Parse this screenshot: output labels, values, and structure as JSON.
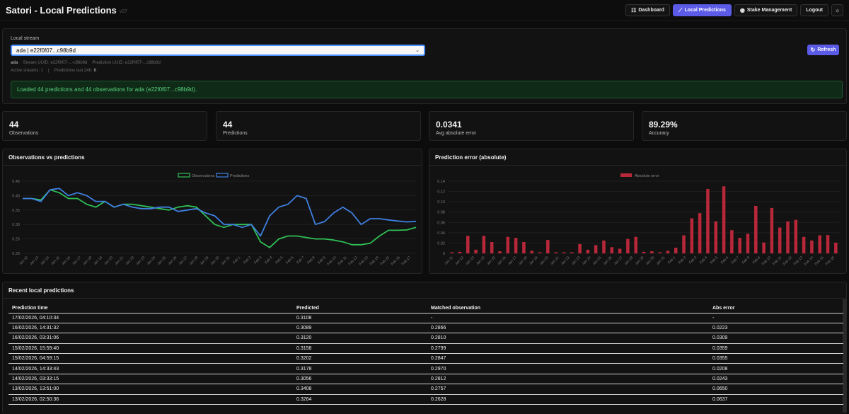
{
  "header": {
    "title": "Satori - Local Predictions",
    "version": "v27",
    "nav": [
      {
        "label": "Dashboard",
        "icon": "dashboard-icon",
        "active": false
      },
      {
        "label": "Local Predictions",
        "icon": "trend-icon",
        "active": true
      },
      {
        "label": "Stake Management",
        "icon": "stake-icon",
        "active": false
      },
      {
        "label": "Logout",
        "icon": "",
        "active": false
      }
    ],
    "theme_toggle_icon": "sun-icon"
  },
  "stream": {
    "label": "Local stream",
    "selected": "ada | e22f0f07...c98b9d",
    "refresh_label": "Refresh",
    "meta_name": "ada",
    "stream_uuid": "Stream UUID: e22f0f07-...-c98b9d",
    "prediction_uuid": "Prediction UUID: e22f0f07-...c98b9d",
    "active_streams": "Active streams: 1",
    "predictions_24h_label": "Predictions last 24h:",
    "predictions_24h": "0",
    "alert": "Loaded 44 predictions and 44 observations for ada (e22f0f07...c98b9d)."
  },
  "stats": [
    {
      "value": "44",
      "label": "Observations"
    },
    {
      "value": "44",
      "label": "Predictions"
    },
    {
      "value": "0.0341",
      "label": "Avg absolute error"
    },
    {
      "value": "89.29%",
      "label": "Accuracy"
    }
  ],
  "colors": {
    "observations": "#2fbf55",
    "predictions": "#3f7fe0",
    "abs_error": "#b8283a",
    "accent": "#5b5be8"
  },
  "chart_data": [
    {
      "type": "line",
      "title": "Observations vs predictions",
      "ylim": [
        0.2,
        0.45
      ],
      "yticks": [
        "0.45",
        "0.40",
        "0.35",
        "0.30",
        "0.25",
        "0.20"
      ],
      "categories": [
        "Jan 12",
        "Jan 13",
        "Jan 14",
        "Jan 15",
        "Jan 16",
        "Jan 17",
        "Jan 18",
        "Jan 19",
        "Jan 20",
        "Jan 21",
        "Jan 22",
        "Jan 23",
        "Jan 24",
        "Jan 25",
        "Jan 26",
        "Jan 27",
        "Jan 28",
        "Jan 29",
        "Jan 30",
        "Jan 31",
        "Feb 1",
        "Feb 2",
        "Feb 3",
        "Feb 4",
        "Feb 5",
        "Feb 6",
        "Feb 7",
        "Feb 8",
        "Feb 9",
        "Feb 10",
        "Feb 11",
        "Feb 12",
        "Feb 13",
        "Feb 14",
        "Feb 15",
        "Feb 16",
        "Feb 17"
      ],
      "legend": "top",
      "series": [
        {
          "name": "Observations",
          "values": [
            0.39,
            0.39,
            0.385,
            0.42,
            0.41,
            0.39,
            0.39,
            0.37,
            0.36,
            0.38,
            0.36,
            0.37,
            0.37,
            0.365,
            0.36,
            0.355,
            0.35,
            0.36,
            0.365,
            0.36,
            0.33,
            0.3,
            0.29,
            0.3,
            0.3,
            0.3,
            0.24,
            0.22,
            0.25,
            0.26,
            0.26,
            0.255,
            0.25,
            0.25,
            0.246,
            0.24,
            0.23,
            0.23,
            0.235,
            0.26,
            0.28,
            0.2799,
            0.2812,
            0.29
          ]
        },
        {
          "name": "Predictions",
          "values": [
            0.39,
            0.39,
            0.38,
            0.42,
            0.425,
            0.4,
            0.41,
            0.4,
            0.38,
            0.38,
            0.36,
            0.37,
            0.36,
            0.355,
            0.355,
            0.36,
            0.36,
            0.345,
            0.35,
            0.355,
            0.34,
            0.33,
            0.3,
            0.3,
            0.29,
            0.3,
            0.26,
            0.33,
            0.36,
            0.37,
            0.4,
            0.39,
            0.3,
            0.31,
            0.34,
            0.36,
            0.34,
            0.3,
            0.32,
            0.3202,
            0.3158,
            0.312,
            0.3089,
            0.3108
          ]
        }
      ]
    },
    {
      "type": "bar",
      "title": "Prediction error (absolute)",
      "ylim": [
        0,
        0.14
      ],
      "yticks": [
        "0.14",
        "0.12",
        "0.10",
        "0.08",
        "0.06",
        "0.04",
        "0.02",
        "0"
      ],
      "categories": [
        "Jan 11",
        "Jan 12",
        "Jan 13",
        "Jan 14",
        "Jan 15",
        "Jan 16",
        "Jan 17",
        "Jan 18",
        "Jan 19",
        "Jan 20",
        "Jan 21",
        "Jan 22",
        "Jan 23",
        "Jan 24",
        "Jan 25",
        "Jan 26",
        "Jan 27",
        "Jan 28",
        "Jan 29",
        "Jan 30",
        "Jan 31",
        "Feb 1",
        "Feb 2",
        "Feb 3",
        "Feb 4",
        "Feb 5",
        "Feb 6",
        "Feb 7",
        "Feb 8",
        "Feb 9",
        "Feb 10",
        "Feb 11",
        "Feb 12",
        "Feb 13",
        "Feb 14",
        "Feb 15",
        "Feb 16"
      ],
      "legend": "top",
      "series": [
        {
          "name": "Absolute error",
          "values": [
            0.002,
            0.003,
            0.034,
            0.007,
            0.034,
            0.022,
            0.004,
            0.032,
            0.03,
            0.022,
            0.005,
            0.002,
            0.026,
            0.002,
            0.002,
            0.002,
            0.018,
            0.007,
            0.016,
            0.025,
            0.012,
            0.009,
            0.028,
            0.032,
            0.003,
            0.004,
            0.002,
            0.005,
            0.011,
            0.035,
            0.068,
            0.078,
            0.125,
            0.062,
            0.13,
            0.045,
            0.03,
            0.038,
            0.092,
            0.021,
            0.088,
            0.05,
            0.062,
            0.065,
            0.032,
            0.025,
            0.035,
            0.0355,
            0.0208
          ]
        }
      ]
    }
  ],
  "table": {
    "title": "Recent local predictions",
    "columns": [
      "Prediction time",
      "Predicted",
      "Matched observation",
      "Abs error"
    ],
    "rows": [
      [
        "17/02/2026, 04:10:34",
        "0.3108",
        "-",
        "-"
      ],
      [
        "16/02/2026, 14:31:32",
        "0.3089",
        "0.2866",
        "0.0223"
      ],
      [
        "16/02/2026, 03:31:06",
        "0.3120",
        "0.2810",
        "0.0309"
      ],
      [
        "15/02/2026, 15:59:40",
        "0.3158",
        "0.2799",
        "0.0359"
      ],
      [
        "15/02/2026, 04:59:15",
        "0.3202",
        "0.2847",
        "0.0355"
      ],
      [
        "14/02/2026, 14:33:43",
        "0.3178",
        "0.2970",
        "0.0208"
      ],
      [
        "14/02/2026, 03:33:15",
        "0.3056",
        "0.2812",
        "0.0243"
      ],
      [
        "13/02/2026, 13:51:00",
        "0.3408",
        "0.2757",
        "0.0650"
      ],
      [
        "13/02/2026, 02:50:36",
        "0.3264",
        "0.2628",
        "0.0637"
      ]
    ]
  }
}
